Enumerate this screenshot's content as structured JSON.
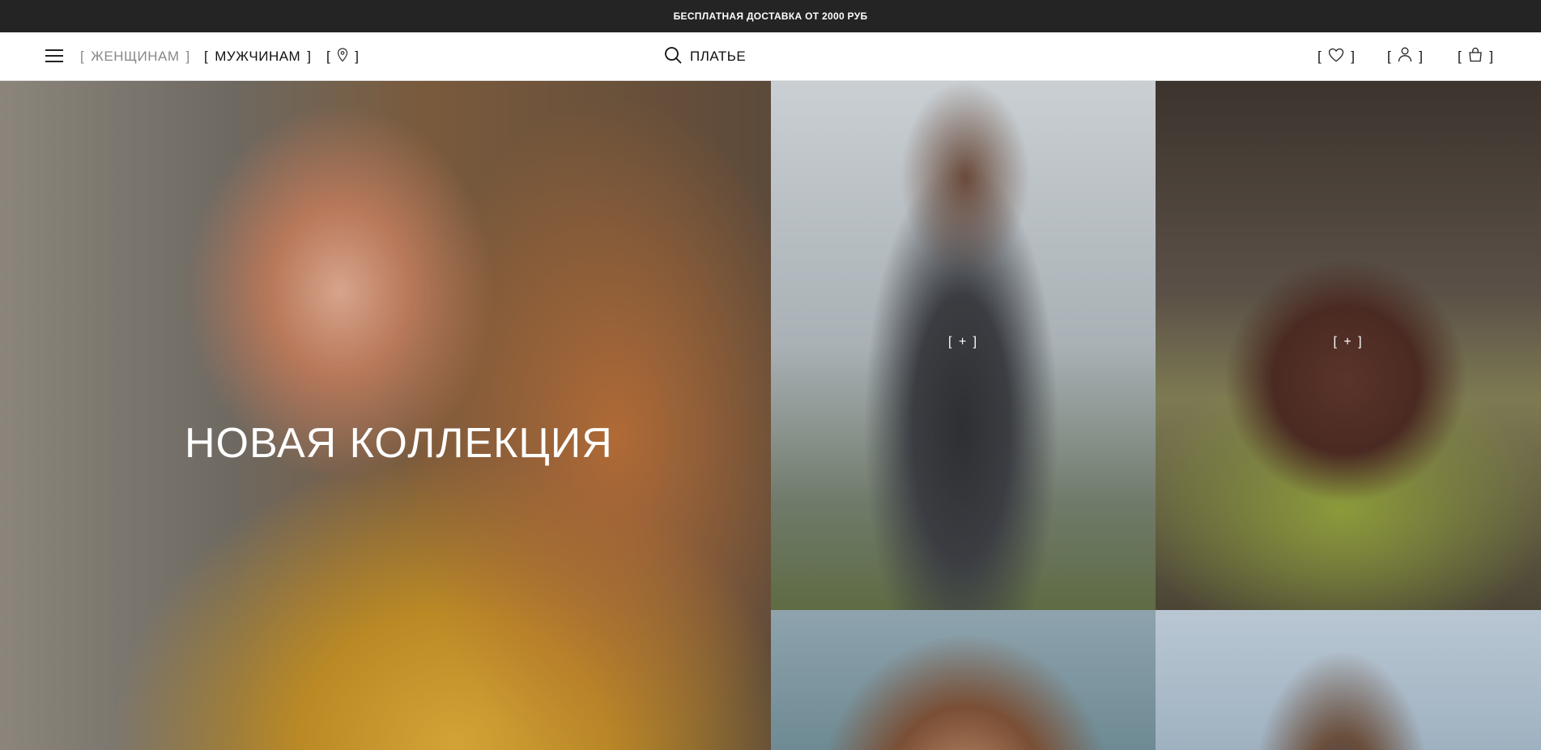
{
  "promo": {
    "text": "БЕСПЛАТНАЯ ДОСТАВКА ОТ 2000 РУБ"
  },
  "header": {
    "menu_icon": "menu-icon",
    "nav": {
      "open": "[",
      "close": "]",
      "women": "ЖЕНЩИНАМ",
      "men": "МУЖЧИНАМ",
      "location_icon": "map-pin-icon"
    },
    "search": {
      "icon": "search-icon",
      "query": "ПЛАТЬЕ"
    },
    "actions": {
      "wishlist_icon": "heart-icon",
      "account_icon": "user-icon",
      "cart_icon": "bag-icon"
    }
  },
  "hero": {
    "title": "НОВАЯ КОЛЛЕКЦИЯ"
  },
  "tiles": [
    {
      "plus": "[ + ]"
    },
    {
      "plus": "[ + ]"
    }
  ]
}
